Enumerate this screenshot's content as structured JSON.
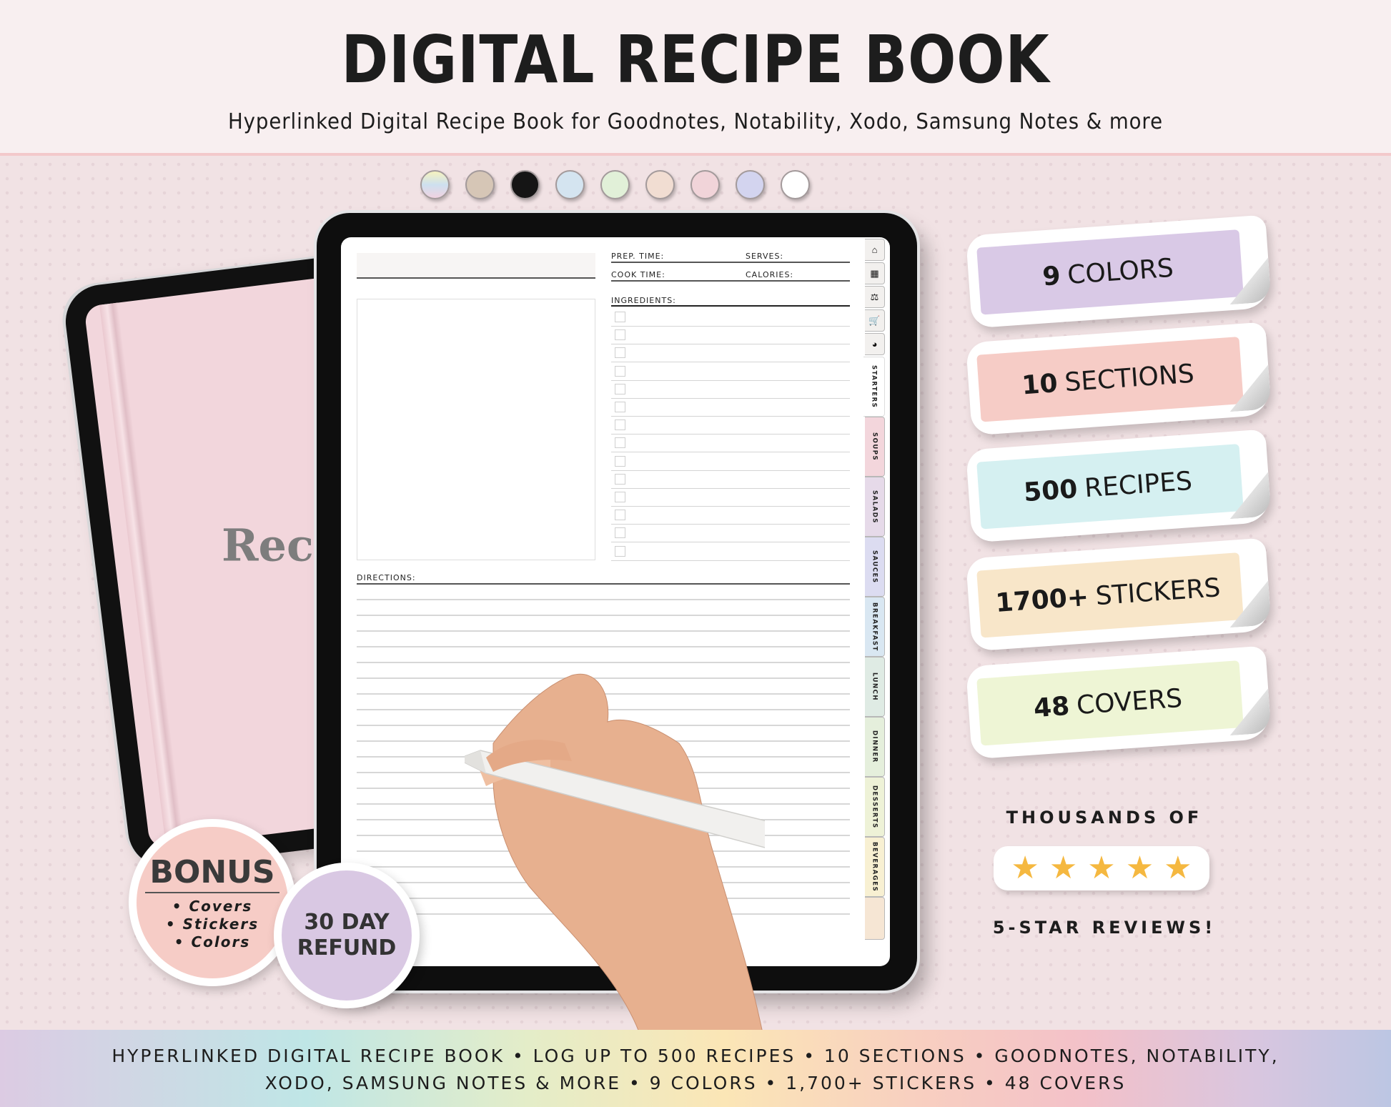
{
  "header": {
    "title": "DIGITAL RECIPE BOOK",
    "subtitle": "Hyperlinked Digital Recipe Book for Goodnotes, Notability, Xodo, Samsung Notes & more"
  },
  "color_swatches": [
    {
      "name": "rainbow",
      "color": "linear-gradient(180deg,#f6f3bf,#cde0ef,#f1d3e1)"
    },
    {
      "name": "taupe",
      "color": "#d6c6b6"
    },
    {
      "name": "black",
      "color": "#151515"
    },
    {
      "name": "blue",
      "color": "#d4e4f0"
    },
    {
      "name": "green",
      "color": "#e1f0d8"
    },
    {
      "name": "peach",
      "color": "#f1ddd2"
    },
    {
      "name": "pink",
      "color": "#f1d4d9"
    },
    {
      "name": "lavender",
      "color": "#d3d4ef"
    },
    {
      "name": "white",
      "color": "#ffffff"
    }
  ],
  "cover": {
    "title": "Recip"
  },
  "recipe_page": {
    "prep_time_label": "PREP. TIME:",
    "serves_label": "SERVES:",
    "cook_time_label": "COOK TIME:",
    "calories_label": "CALORIES:",
    "ingredients_label": "INGREDIENTS:",
    "directions_label": "DIRECTIONS:",
    "ingredient_rows": 14,
    "direction_rows": 21
  },
  "nav_icons": [
    {
      "name": "home",
      "glyph": "⌂"
    },
    {
      "name": "calendar",
      "glyph": "▦"
    },
    {
      "name": "scale",
      "glyph": "⚖"
    },
    {
      "name": "cart",
      "glyph": "🛒"
    },
    {
      "name": "pie-chart",
      "glyph": "◕"
    }
  ],
  "section_tabs": [
    {
      "label": "STARTERS",
      "color": "#ffffff",
      "active": true
    },
    {
      "label": "SOUPS",
      "color": "#f3d6dc"
    },
    {
      "label": "SALADS",
      "color": "#e6dae9"
    },
    {
      "label": "SAUCES",
      "color": "#dcdcf1"
    },
    {
      "label": "BREAKFAST",
      "color": "#d9e7f2"
    },
    {
      "label": "LUNCH",
      "color": "#dfebe4"
    },
    {
      "label": "DINNER",
      "color": "#e5efdc"
    },
    {
      "label": "DESSERTS",
      "color": "#eef2d7"
    },
    {
      "label": "BEVERAGES",
      "color": "#f8f0d2"
    },
    {
      "label": "",
      "color": "#f6e6d4"
    }
  ],
  "features": [
    {
      "number": "9",
      "text": "COLORS",
      "color": "#d9c9e6"
    },
    {
      "number": "10",
      "text": "SECTIONS",
      "color": "#f6ccc6"
    },
    {
      "number": "500",
      "text": "RECIPES",
      "color": "#d5f0f1"
    },
    {
      "number": "1700+",
      "text": "STICKERS",
      "color": "#f8e6c9"
    },
    {
      "number": "48",
      "text": "COVERS",
      "color": "#eef5d5"
    }
  ],
  "reviews": {
    "top": "THOUSANDS OF",
    "rating": 5,
    "max_rating": 5,
    "bottom": "5-STAR REVIEWS!",
    "star_color": "#f5b840"
  },
  "bonus_badge": {
    "title": "BONUS",
    "items": [
      "• Covers",
      "• Stickers",
      "• Colors"
    ]
  },
  "refund_badge": {
    "line1": "30 DAY",
    "line2": "REFUND"
  },
  "footer": {
    "line1": "HYPERLINKED DIGITAL RECIPE BOOK • LOG UP TO 500 RECIPES • 10 SECTIONS • GOODNOTES, NOTABILITY,",
    "line2": "XODO, SAMSUNG NOTES & MORE  • 9 COLORS • 1,700+ STICKERS • 48 COVERS"
  }
}
